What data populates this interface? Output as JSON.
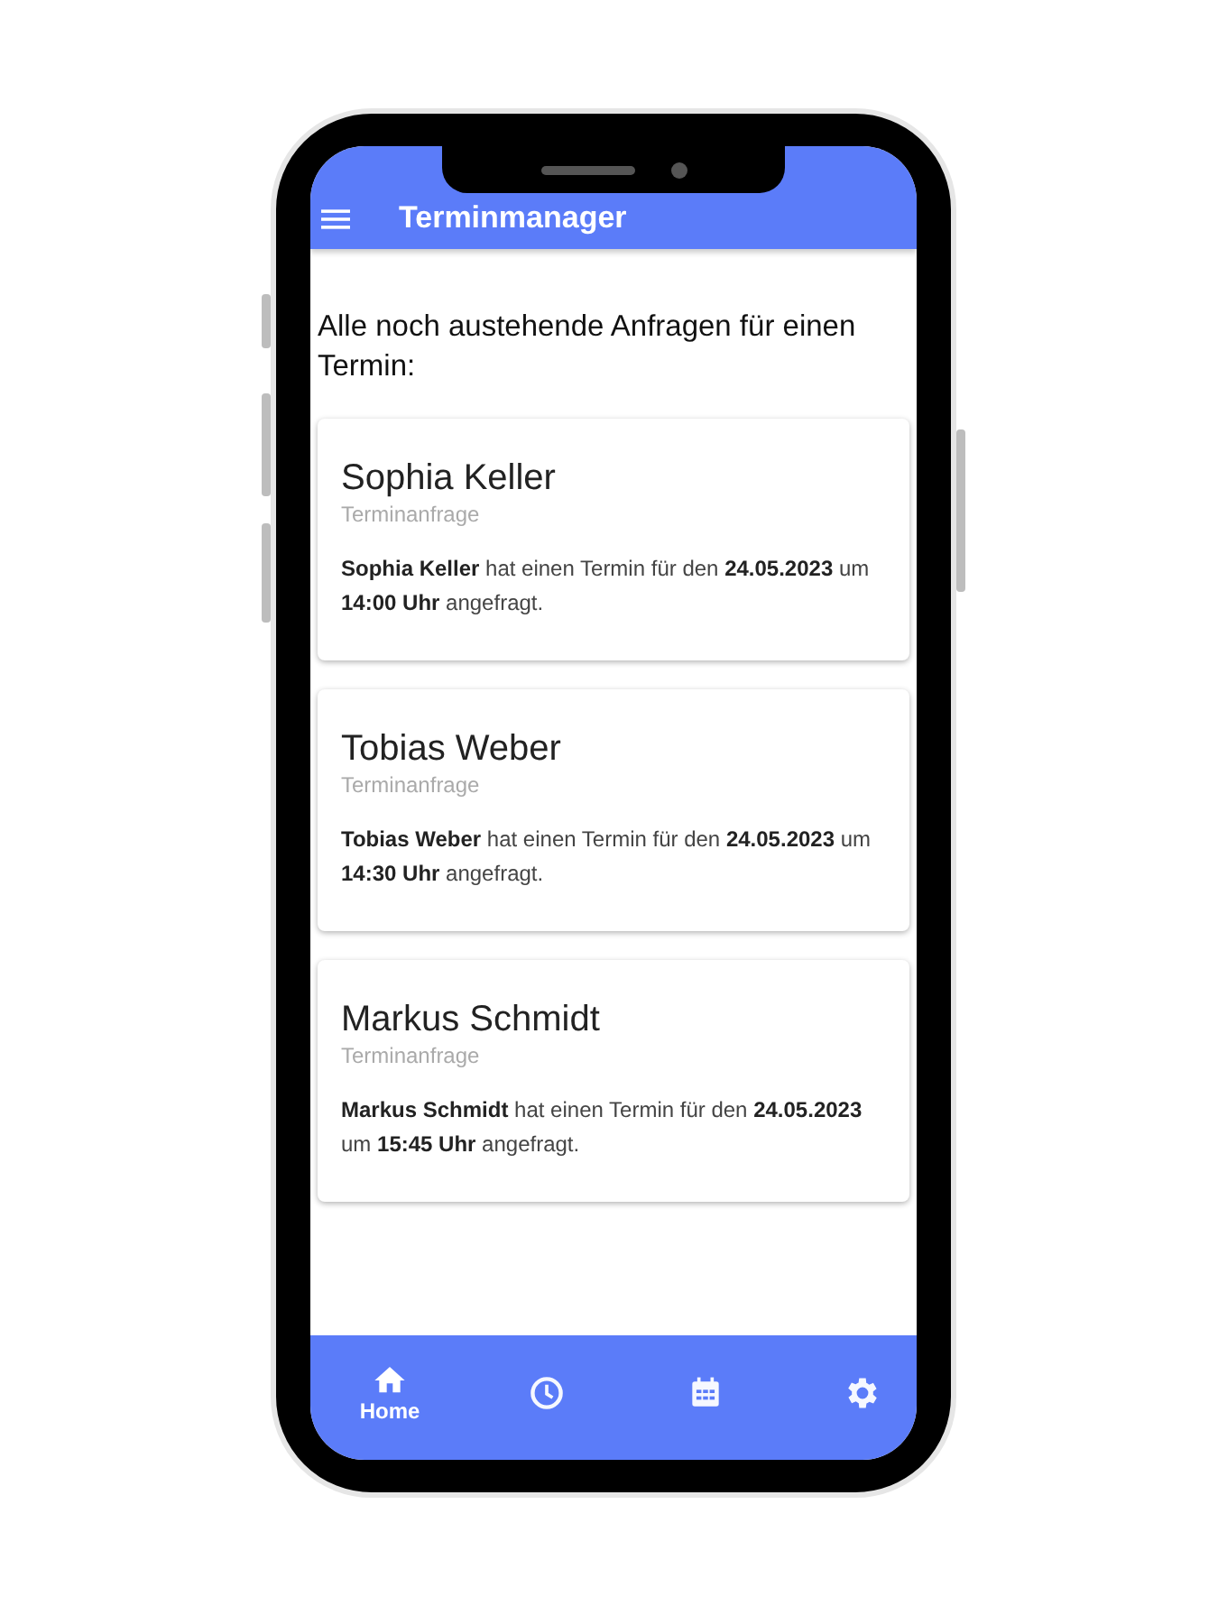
{
  "app_bar": {
    "title": "Terminmanager"
  },
  "heading": "Alle noch austehende Anfragen für einen Termin:",
  "cards": [
    {
      "name": "Sophia Keller",
      "subtitle": "Terminanfrage",
      "text": "**Sophia Keller** hat einen Termin für den **24.05.2023** um **14:00 Uhr** angefragt."
    },
    {
      "name": "Tobias Weber",
      "subtitle": "Terminanfrage",
      "text": "**Tobias Weber** hat einen Termin für den **24.05.2023** um **14:30 Uhr** angefragt."
    },
    {
      "name": "Markus Schmidt",
      "subtitle": "Terminanfrage",
      "text": "**Markus Schmidt** hat einen Termin für den **24.05.2023** um **15:45 Uhr** angefragt."
    }
  ],
  "bottom_nav": [
    {
      "kind": "home",
      "label": "Home",
      "selected": true
    },
    {
      "kind": "clock",
      "selected": false
    },
    {
      "kind": "calendar",
      "selected": false
    },
    {
      "kind": "settings",
      "selected": false
    }
  ]
}
